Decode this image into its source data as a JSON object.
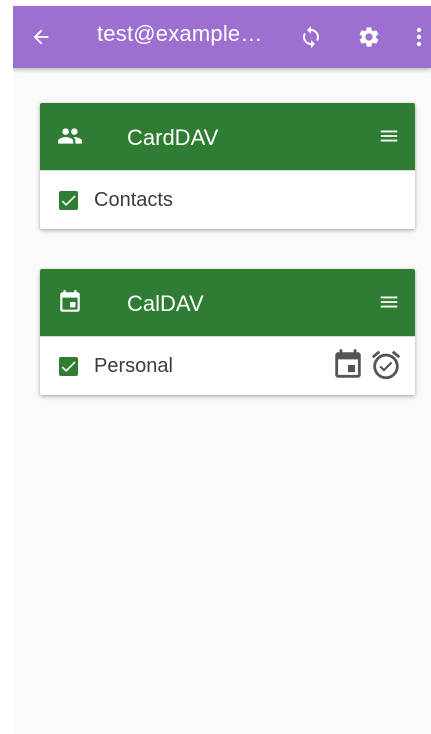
{
  "appbar": {
    "title": "test@example…",
    "back_icon": "arrow-left-icon",
    "sync_icon": "sync-icon",
    "settings_icon": "gear-icon",
    "overflow_icon": "more-vert-icon",
    "color": "#9c6fd0"
  },
  "carddav": {
    "title": "CardDAV",
    "icon": "people-icon",
    "menu_icon": "menu-icon",
    "items": [
      {
        "label": "Contacts",
        "checked": true
      }
    ]
  },
  "caldav": {
    "title": "CalDAV",
    "icon": "calendar-icon",
    "menu_icon": "menu-icon",
    "items": [
      {
        "label": "Personal",
        "checked": true,
        "icons": [
          "calendar-event-icon",
          "alarm-check-icon"
        ]
      }
    ]
  },
  "colors": {
    "header_green": "#2e7d32",
    "background": "#fafafa"
  }
}
